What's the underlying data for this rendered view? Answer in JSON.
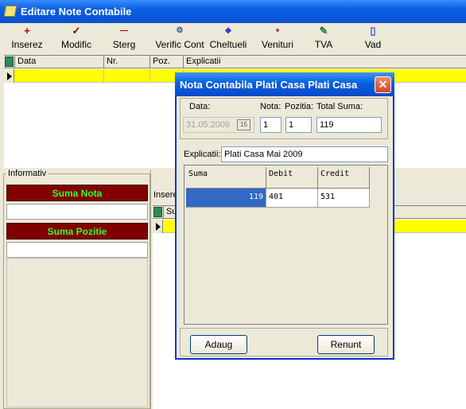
{
  "window": {
    "title": "Editare Note Contabile"
  },
  "toolbar": [
    {
      "label": "Inserez",
      "icon": "plus-icon",
      "glyph": "+"
    },
    {
      "label": "Modific",
      "icon": "checkmark-icon",
      "glyph": "✓"
    },
    {
      "label": "Sterg",
      "icon": "minus-icon",
      "glyph": "—"
    },
    {
      "label": "Verific Cont",
      "icon": "verify-icon",
      "glyph": "⚙"
    },
    {
      "label": "Cheltueli",
      "icon": "expenses-icon",
      "glyph": "◆"
    },
    {
      "label": "Venituri",
      "icon": "income-icon",
      "glyph": "♦"
    },
    {
      "label": "TVA",
      "icon": "vat-icon",
      "glyph": "✎"
    },
    {
      "label": "Vad",
      "icon": "view-icon",
      "glyph": "▯"
    }
  ],
  "top_grid": {
    "columns": [
      "Data",
      "Nr.",
      "Poz.",
      "Explicatii"
    ]
  },
  "info_panel": {
    "group_label": "Informativ",
    "suma_nota_label": "Suma Nota",
    "suma_pozitie_label": "Suma Pozitie"
  },
  "right_panel": {
    "insert_label": "Insere",
    "grid_col": "Su"
  },
  "dialog": {
    "title": "Nota Contabila Plati Casa Plati Casa",
    "close_glyph": "✕",
    "data_label": "Data:",
    "data_value": "31.05.2009",
    "cal_glyph": "15",
    "nota_label": "Nota:",
    "nota_value": "1",
    "pozitia_label": "Pozitia:",
    "pozitia_value": "1",
    "total_label": "Total Suma:",
    "total_value": "119",
    "explicatii_label": "Explicatii:",
    "explicatii_value": "Plati Casa Mai       2009",
    "grid": {
      "columns": [
        "Suma",
        "Debit",
        "Credit"
      ],
      "row": [
        "119",
        "401",
        "531"
      ]
    },
    "add_button": "Adaug",
    "cancel_button": "Renunt"
  }
}
